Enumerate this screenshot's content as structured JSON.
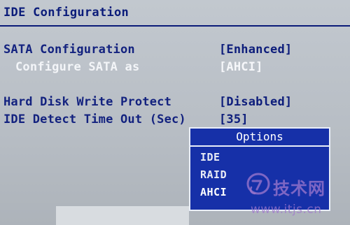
{
  "title": "IDE Configuration",
  "rows": [
    {
      "label": "SATA Configuration",
      "value": "[Enhanced]"
    },
    {
      "label": "Configure SATA as",
      "value": "[AHCI]"
    },
    {
      "label": "Hard Disk Write Protect",
      "value": "[Disabled]"
    },
    {
      "label": "IDE Detect Time Out (Sec)",
      "value": "[35]"
    }
  ],
  "options_popup": {
    "title": "Options",
    "items": [
      "IDE",
      "RAID",
      "AHCI"
    ],
    "selected": "AHCI"
  },
  "watermark": {
    "title": "技术网",
    "url": "www.itjs.cn"
  },
  "colors": {
    "background": "#b9bfc6",
    "label_text": "#13227f",
    "highlight_text": "#f6f7fa",
    "popup_background": "#1630a8",
    "popup_border": "#e9eef8"
  }
}
